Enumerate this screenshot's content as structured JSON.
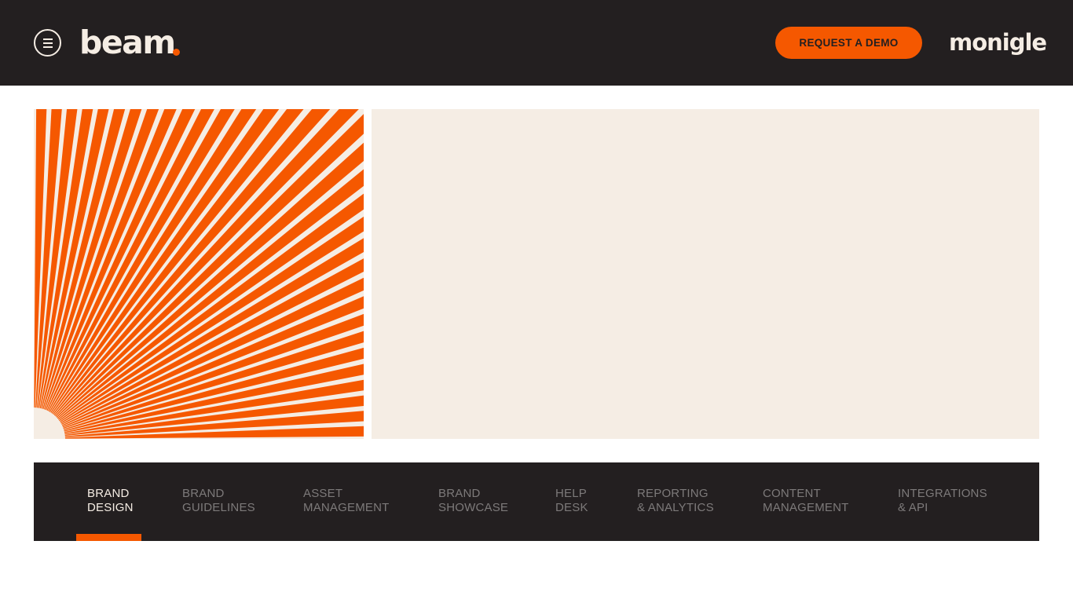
{
  "colors": {
    "brand_orange": "#f55800",
    "dark": "#231f20",
    "cream": "#f5ede4",
    "tab_inactive": "#7d7a7a"
  },
  "header": {
    "menu_icon": "hamburger-menu-icon",
    "logo_text": "beam",
    "cta_label": "REQUEST A DEMO",
    "partner_logo_text": "monigle"
  },
  "tabs": [
    {
      "line1": "BRAND",
      "line2": "DESIGN",
      "active": true
    },
    {
      "line1": "BRAND",
      "line2": "GUIDELINES",
      "active": false
    },
    {
      "line1": "ASSET",
      "line2": "MANAGEMENT",
      "active": false
    },
    {
      "line1": "BRAND",
      "line2": "SHOWCASE",
      "active": false
    },
    {
      "line1": "HELP",
      "line2": "DESK",
      "active": false
    },
    {
      "line1": "REPORTING",
      "line2": "& ANALYTICS",
      "active": false
    },
    {
      "line1": "CONTENT",
      "line2": "MANAGEMENT",
      "active": false
    },
    {
      "line1": "INTEGRATIONS",
      "line2": "& API",
      "active": false
    }
  ]
}
